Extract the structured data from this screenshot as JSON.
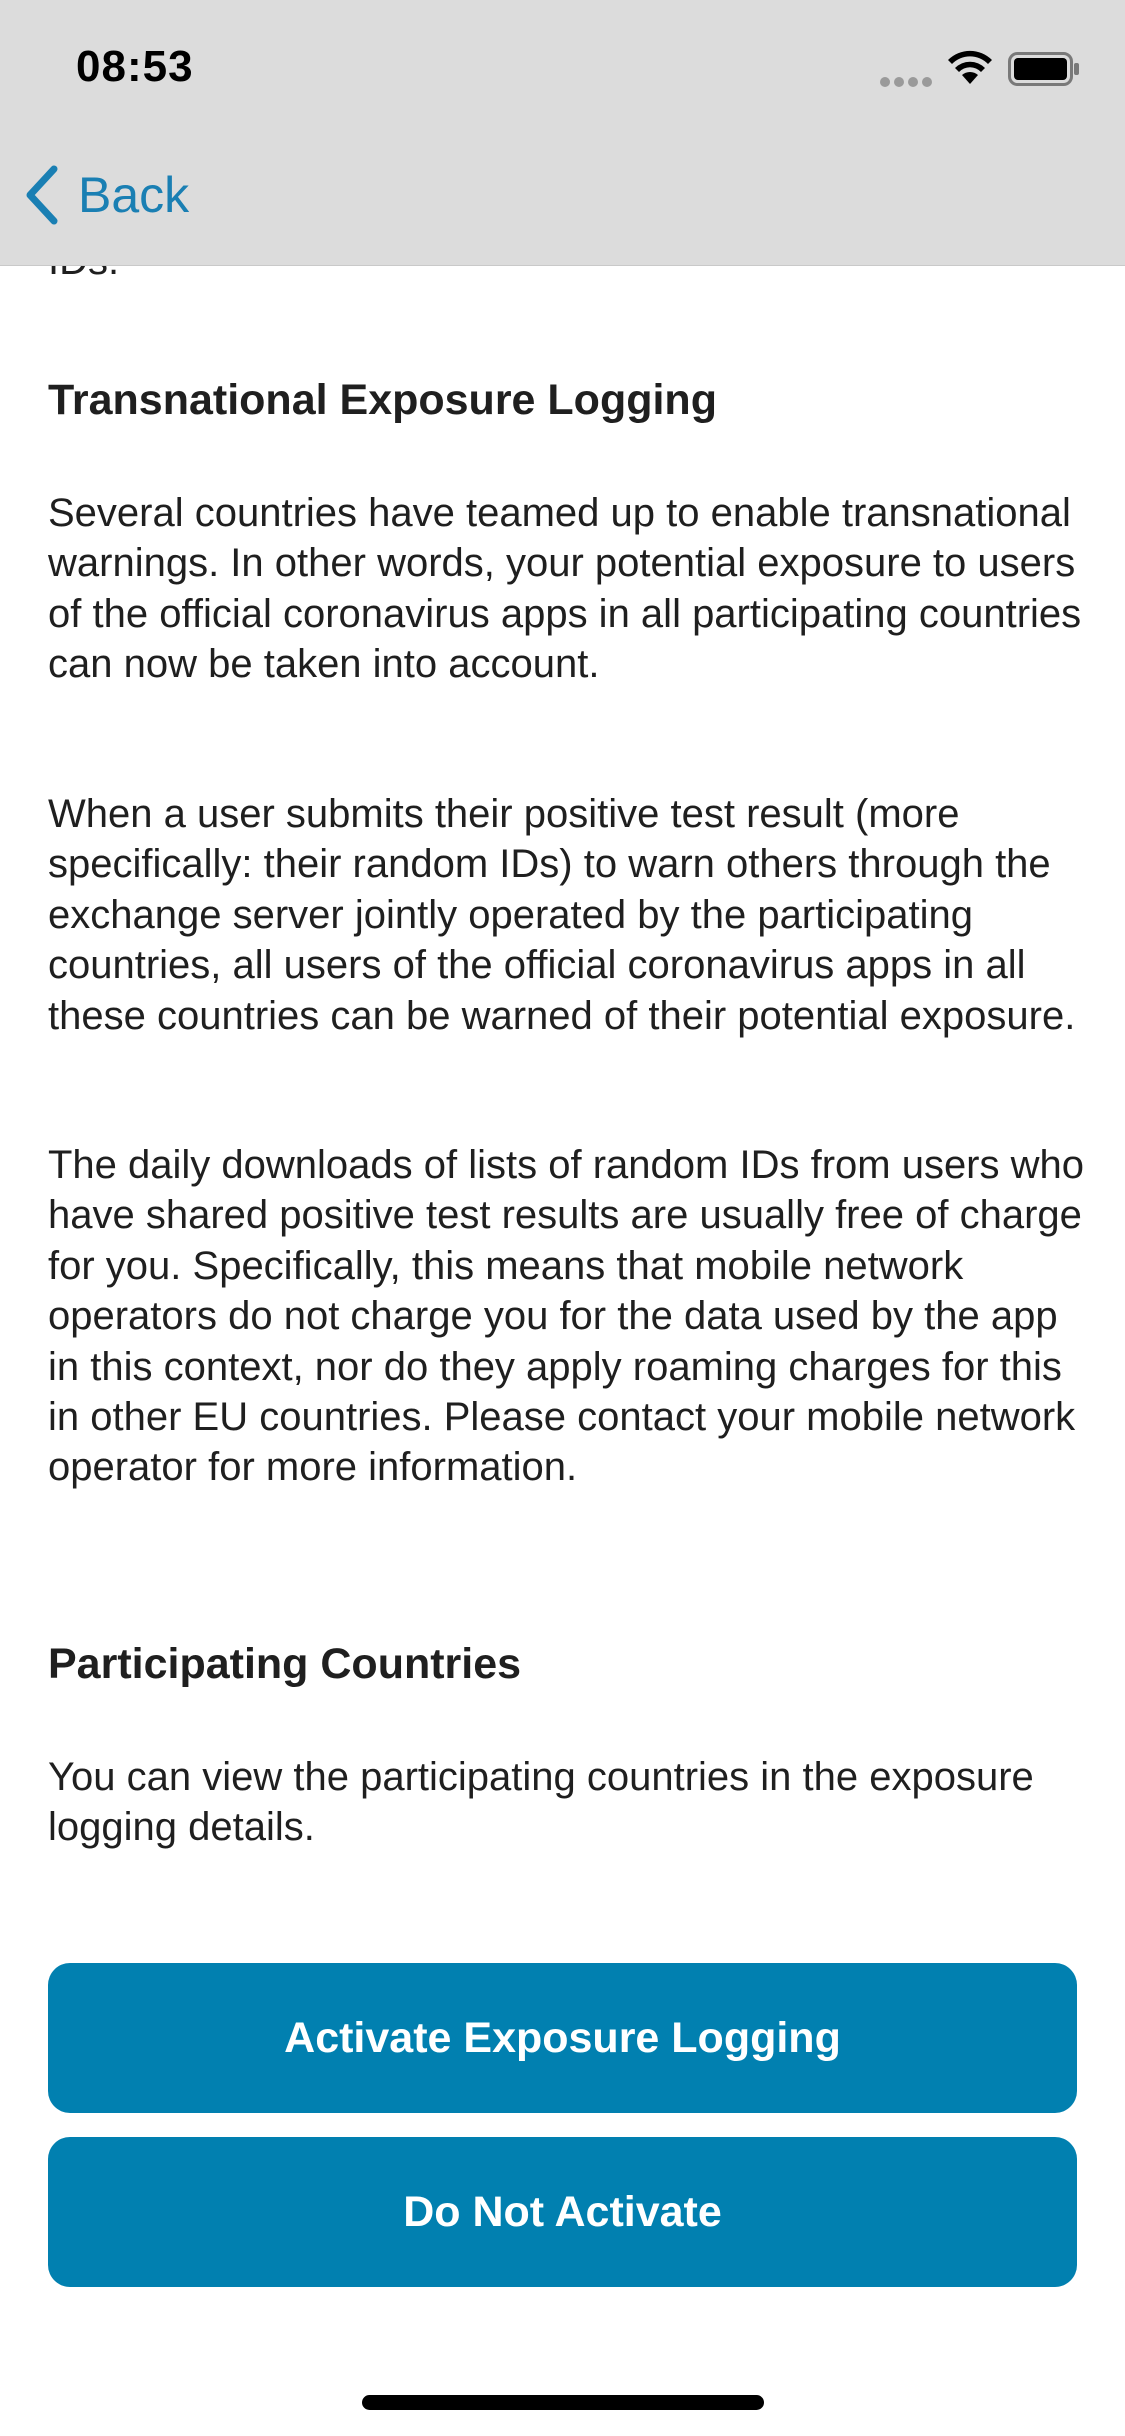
{
  "status_bar": {
    "time": "08:53",
    "icons": [
      "cellular-dots-icon",
      "wifi-icon",
      "battery-icon"
    ]
  },
  "nav": {
    "back_label": "Back",
    "back_icon": "chevron-left-icon",
    "accent_color": "#1a7fb3"
  },
  "content": {
    "clipped_text": "IDs.",
    "transnational": {
      "title": "Transnational Exposure Logging",
      "paragraphs": [
        "Several countries have teamed up to enable transnational warnings. In other words, your potential exposure to users of the official coronavirus apps in all participating countries can now be taken into account.",
        "When a user submits their positive test result (more specifically: their random IDs) to warn others through the exchange server jointly operated by the participating countries, all users of the official coronavirus apps in all these countries can be warned of their potential exposure.",
        "The daily downloads of lists of random IDs from users who have shared positive test results are usually free of charge for you. Specifically, this means that mobile network operators do not charge you for the data used by the app in this context, nor do they apply roaming charges for this in other EU countries. Please contact your mobile network operator for more information."
      ]
    },
    "participating": {
      "title": "Participating Countries",
      "paragraph": "You can view the participating countries in the exposure logging details."
    }
  },
  "actions": {
    "activate_label": "Activate Exposure Logging",
    "do_not_activate_label": "Do Not Activate",
    "button_color": "#0180b0"
  }
}
